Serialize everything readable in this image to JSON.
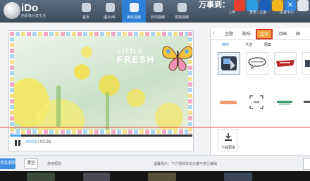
{
  "app": {
    "logo_text": "iDo",
    "logo_sub": "用影像分享生活"
  },
  "nav": {
    "items": [
      {
        "label": "首页",
        "icon": "home-icon",
        "active": false
      },
      {
        "label": "图片WF",
        "icon": "image-icon",
        "active": false
      },
      {
        "label": "美化视频",
        "icon": "brush-icon",
        "active": true
      },
      {
        "label": "剪切视频",
        "icon": "scissors-icon",
        "active": false
      },
      {
        "label": "拼接视频",
        "icon": "film-icon",
        "active": false
      }
    ]
  },
  "header_right": {
    "big_text": "万事到：",
    "upload": "上传",
    "account": "登录 | 注册",
    "settings": "设置中心",
    "social_icons": [
      "weibo-icon",
      "tencent-weibo-icon",
      "renren-icon",
      "qzone-icon",
      "close-icon",
      "more-icon"
    ]
  },
  "preview": {
    "overlay_text_1": "LITTLE",
    "overlay_text_2": "FRESH",
    "time_current": "00:03",
    "time_total": "00:26",
    "progress": 0.06
  },
  "stickers": {
    "tabs": [
      "主题",
      "配乐",
      "文字",
      "动画",
      "画"
    ],
    "active_tab": "文字",
    "subtabs": [
      "简约",
      "气泡",
      "图案"
    ],
    "active_subtab": "简约",
    "download_more": "下载更多",
    "colors": {
      "tab_active": "#f7a33c",
      "tab_highlight_border": "#d93a2d"
    }
  },
  "toolbar": {
    "add_video": "添加视频",
    "clear": "清空",
    "help": "使用帮助",
    "tip": "温馨提示：下方视频单击右键可进行编辑"
  },
  "colors": {
    "accent": "#2d80d6",
    "header_bg": "#3a4a5b",
    "marker_line": "#e8332b"
  }
}
